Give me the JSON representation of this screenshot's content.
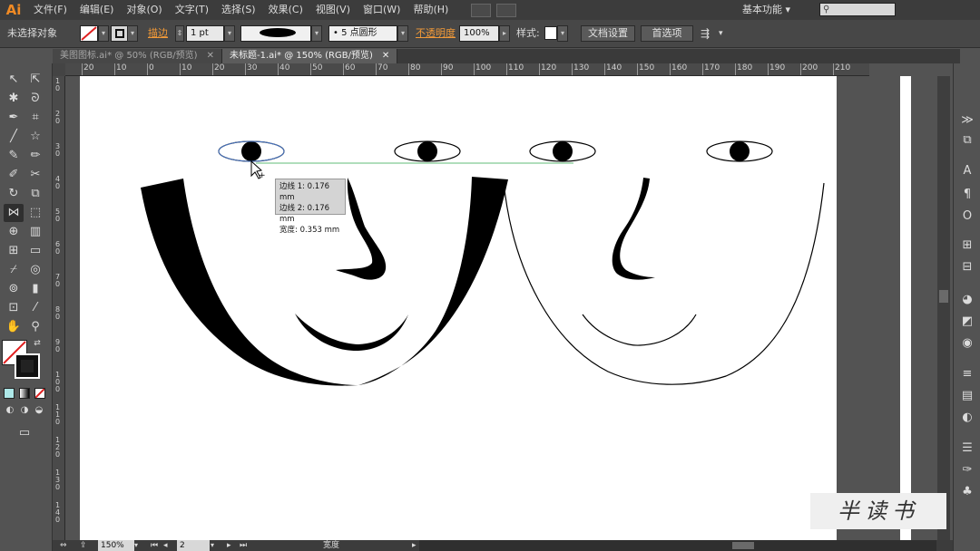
{
  "app": {
    "logo": "Ai",
    "workspace": "基本功能 ▾"
  },
  "menu": [
    "文件(F)",
    "编辑(E)",
    "对象(O)",
    "文字(T)",
    "选择(S)",
    "效果(C)",
    "视图(V)",
    "窗口(W)",
    "帮助(H)"
  ],
  "control": {
    "selection_status": "未选择对象",
    "stroke_label": "描边",
    "stroke_weight": "1 pt",
    "brush_size": "5 点圆形",
    "opacity_label": "不透明度",
    "opacity_value": "100%",
    "style_label": "样式:",
    "doc_setup": "文档设置",
    "preferences": "首选项"
  },
  "tabs": [
    {
      "label": "美图图标.ai* @ 50% (RGB/预览)",
      "close": "✕"
    },
    {
      "label": "未标题-1.ai* @ 150% (RGB/预览)",
      "close": "✕"
    }
  ],
  "ruler": {
    "h_ticks": [
      "20",
      "10",
      "0",
      "10",
      "20",
      "30",
      "40",
      "50",
      "60",
      "70",
      "80",
      "90",
      "100",
      "110",
      "120",
      "130",
      "140",
      "150",
      "160",
      "170",
      "180",
      "190",
      "200",
      "210"
    ],
    "v_ticks": [
      "1 0",
      "2 0",
      "3 0",
      "4 0",
      "5 0",
      "6 0",
      "7 0",
      "8 0",
      "9 0",
      "1 0 0",
      "1 1 0",
      "1 2 0",
      "1 3 0",
      "1 4 0"
    ]
  },
  "tooltip": {
    "line1": "边线 1: 0.176 mm",
    "line2": "边线 2: 0.176 mm",
    "line3": "宽度:  0.353 mm"
  },
  "status": {
    "zoom": "150%",
    "page": "2",
    "tool": "宽度"
  },
  "watermark": "半读书",
  "colors": {
    "accent_orange": "#f29a38",
    "logo_orange": "#f08a24"
  }
}
